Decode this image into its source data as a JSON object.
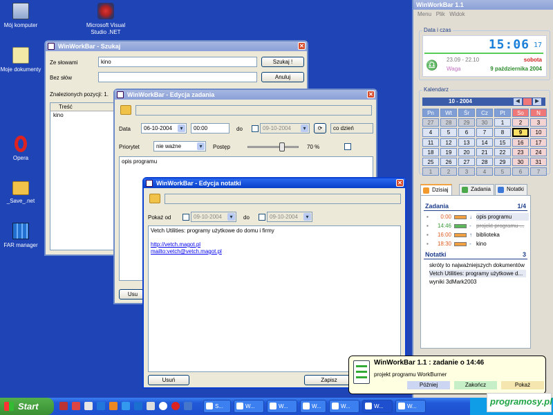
{
  "desktop_icons": [
    {
      "label": "Mój komputer",
      "icon": "computer-icon"
    },
    {
      "label": "Microsoft Visual Studio .NET",
      "icon": "visual-studio-icon"
    },
    {
      "label": "Moje dokumenty",
      "icon": "my-documents-icon"
    },
    {
      "label": "Opera",
      "icon": "opera-icon"
    },
    {
      "label": "_Save_.net",
      "icon": "folder-icon"
    },
    {
      "label": "FAR manager",
      "icon": "far-manager-icon"
    }
  ],
  "search_window": {
    "title": "WinWorkBar - Szukaj",
    "with_words_label": "Ze słowami",
    "with_words_value": "kino",
    "without_words_label": "Bez słów",
    "without_words_value": "",
    "search_button": "Szukaj !",
    "cancel_button": "Anuluj",
    "found_label": "Znalezionych pozycji: 1.",
    "column_header": "Treść",
    "results": [
      "kino"
    ]
  },
  "task_edit_window": {
    "title": "WinWorkBar - Edycja zadania",
    "date_label": "Data",
    "date_value": "06-10-2004",
    "time_value": "00:00",
    "to_label": "do",
    "to_date_value": "09-10-2004",
    "repeat_value": "co dzień",
    "priority_label": "Priorytet",
    "priority_value": "nie ważne",
    "progress_label": "Postęp",
    "progress_text": "70 %",
    "progress_value": 0.7,
    "description": "opis programu",
    "bottom_button": "Usu"
  },
  "note_edit_window": {
    "title": "WinWorkBar - Edycja notatki",
    "show_from_label": "Pokaż od",
    "show_from_value": "09-10-2004",
    "to_label": "do",
    "to_value": "09-10-2004",
    "text_line1": "Vetch Utilities: programy użytkowe do domu i firmy",
    "link1": "http://vetch.magot.pl",
    "link2": "mailto:vetch@vetch.magot.pl",
    "remove_button": "Usuń",
    "save_button": "Zapisz"
  },
  "sidebar": {
    "title": "WinWorkBar 1.1",
    "menu": [
      "Menu",
      "Plik",
      "Widok"
    ],
    "datetime_label": "Data i czas",
    "clock": "15:06",
    "clock_seconds": "17",
    "range": "23.09 - 22.10",
    "sign": "Waga",
    "weekday": "sobota",
    "date_long": "9 października 2004",
    "calendar_label": "Kalendarz",
    "month": "10 - 2004",
    "weekdays": [
      "Pn",
      "Wt",
      "Śr",
      "Cz",
      "Pt",
      "So",
      "N"
    ],
    "weeks": [
      [
        "27",
        "28",
        "29",
        "30",
        "1",
        "2",
        "3"
      ],
      [
        "4",
        "5",
        "6",
        "7",
        "8",
        "9",
        "10"
      ],
      [
        "11",
        "12",
        "13",
        "14",
        "15",
        "16",
        "17"
      ],
      [
        "18",
        "19",
        "20",
        "21",
        "22",
        "23",
        "24"
      ],
      [
        "25",
        "26",
        "27",
        "28",
        "29",
        "30",
        "31"
      ],
      [
        "1",
        "2",
        "3",
        "4",
        "5",
        "6",
        "7"
      ]
    ],
    "today": "9",
    "tabs": [
      "Dzisiaj",
      "Zadania",
      "Notatki"
    ],
    "tasks_header": "Zadania",
    "tasks_count": "1/4",
    "tasks": [
      {
        "time": "0:00",
        "text": "opis programu",
        "done": false,
        "color": "#f0a040",
        "arrow": "↓"
      },
      {
        "time": "14:46",
        "text": "projekt programu ...",
        "done": true,
        "color": "#5bb85b",
        "arrow": "-"
      },
      {
        "time": "16:00",
        "text": "biblioteka",
        "done": false,
        "color": "#f0a040",
        "arrow": "↑"
      },
      {
        "time": "18:30",
        "text": "kino",
        "done": false,
        "color": "#f0a040",
        "arrow": "-"
      }
    ],
    "notes_header": "Notatki",
    "notes_count": "3",
    "notes": [
      "skróty to najważniejszych dokumentów",
      "Vetch Utilities: programy użytkowe d...",
      "wyniki 3dMark2003"
    ]
  },
  "notification": {
    "title": "WinWorkBar 1.1 : zadanie o 14:46",
    "text": "projekt programu WorkBurner",
    "buttons": [
      "Później",
      "Zakończ",
      "Pokaż"
    ]
  },
  "taskbar": {
    "start": "Start",
    "buttons": [
      "S...",
      "W...",
      "W...",
      "W...",
      "W...",
      "W...",
      "W..."
    ]
  },
  "watermark": "programosy.pl"
}
